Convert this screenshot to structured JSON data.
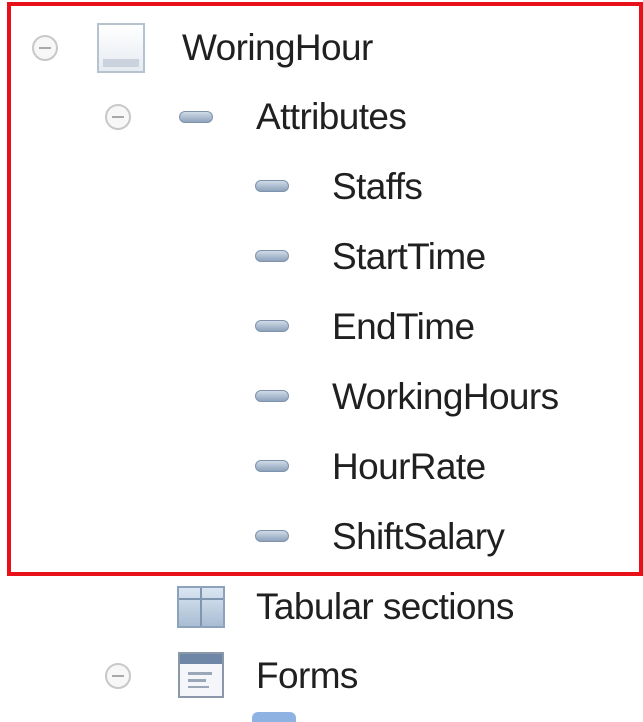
{
  "tree": {
    "root": {
      "label": "WoringHour",
      "icon": "catalog-icon",
      "expanded": true
    },
    "attributes": {
      "label": "Attributes",
      "icon": "attribute-icon",
      "expanded": true,
      "items": [
        {
          "label": "Staffs",
          "icon": "attribute-icon"
        },
        {
          "label": "StartTime",
          "icon": "attribute-icon"
        },
        {
          "label": "EndTime",
          "icon": "attribute-icon"
        },
        {
          "label": "WorkingHours",
          "icon": "attribute-icon"
        },
        {
          "label": "HourRate",
          "icon": "attribute-icon"
        },
        {
          "label": "ShiftSalary",
          "icon": "attribute-icon"
        }
      ]
    },
    "tabular_sections": {
      "label": "Tabular sections",
      "icon": "tabular-section-icon"
    },
    "forms": {
      "label": "Forms",
      "icon": "form-icon",
      "expanded": true
    }
  },
  "highlight": {
    "color": "#e8111a"
  }
}
